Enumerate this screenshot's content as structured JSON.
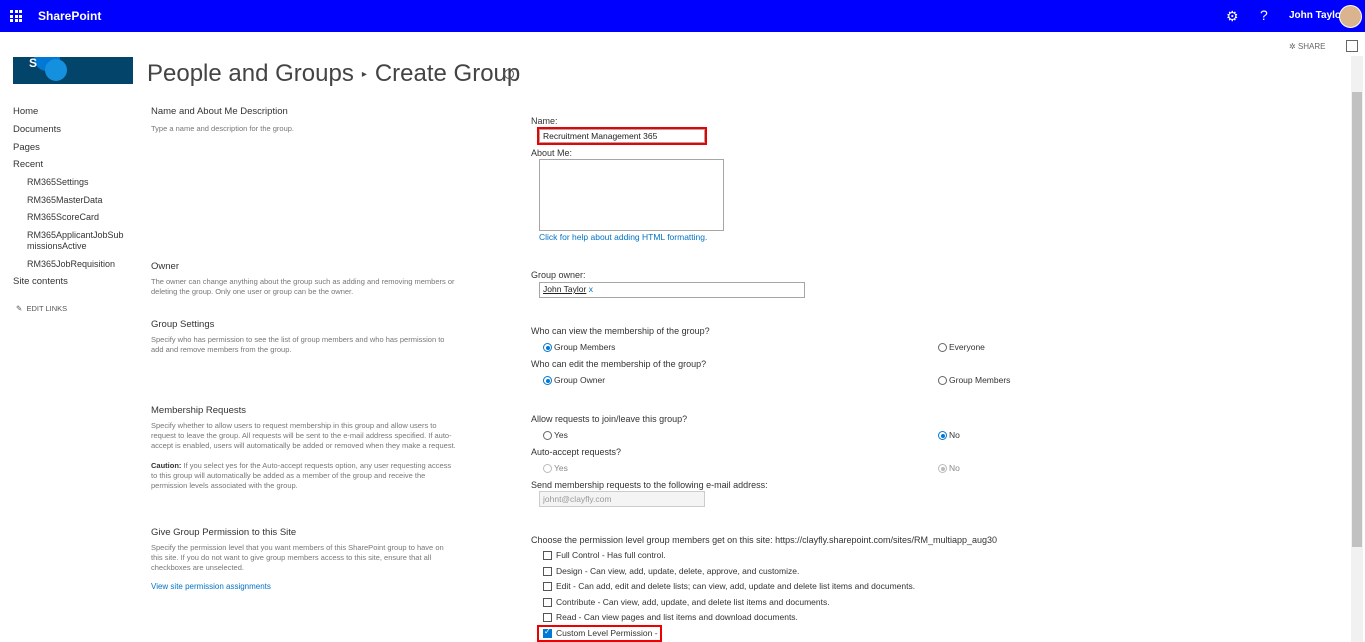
{
  "suitebar": {
    "app_name": "SharePoint",
    "user_name": "John Taylor"
  },
  "commandbar": {
    "share_label": "SHARE"
  },
  "page": {
    "breadcrumb_parent": "People and Groups",
    "breadcrumb_separator": "▸",
    "title": "Create Group"
  },
  "nav": {
    "items": [
      "Home",
      "Documents",
      "Pages",
      "Recent"
    ],
    "recent": [
      "RM365Settings",
      "RM365MasterData",
      "RM365ScoreCard",
      "RM365ApplicantJobSub",
      "missionsActive",
      "RM365JobRequisition"
    ],
    "site_contents": "Site contents",
    "edit_links": "EDIT LINKS"
  },
  "sections": {
    "name": {
      "heading": "Name and About Me Description",
      "desc": "Type a name and description for the group.",
      "name_label": "Name:",
      "name_value": "Recruitment Management 365",
      "about_label": "About Me:",
      "help_link": "Click for help about adding HTML formatting."
    },
    "owner": {
      "heading": "Owner",
      "desc1": "The owner can change anything about the group such as adding and removing members or",
      "desc2": "deleting the group. Only one user or group can be the owner.",
      "label": "Group owner:",
      "value": "John Taylor",
      "remove": "x"
    },
    "settings": {
      "heading": "Group Settings",
      "desc1": "Specify who has permission to see the list of group members and who has permission to",
      "desc2": "add and remove members from the group.",
      "view_q": "Who can view the membership of the group?",
      "view_opt1": "Group Members",
      "view_opt2": "Everyone",
      "edit_q": "Who can edit the membership of the group?",
      "edit_opt1": "Group Owner",
      "edit_opt2": "Group Members"
    },
    "membership": {
      "heading": "Membership Requests",
      "desc1": "Specify whether to allow users to request membership in this group and allow users to",
      "desc2": "request to leave the group. All requests will be sent to the e-mail address specified. If auto-",
      "desc3": "accept is enabled, users will automatically be added or removed when they make a request.",
      "caution_label": "Caution:",
      "caution1": " If you select yes for the Auto-accept requests option, any user requesting access",
      "caution2": "to this group will automatically be added as a member of the group and receive the",
      "caution3": "permission levels associated with the group.",
      "allow_q": "Allow requests to join/leave this group?",
      "yes": "Yes",
      "no": "No",
      "auto_q": "Auto-accept requests?",
      "email_label": "Send membership requests to the following e-mail address:",
      "email_value": "johnt@clayfly.com"
    },
    "permission": {
      "heading": "Give Group Permission to this Site",
      "desc1": "Specify the permission level that you want members of this SharePoint group to have on",
      "desc2": "this site. If you do not want to give group members access to this site, ensure that all",
      "desc3": "checkboxes are unselected.",
      "view_link": "View site permission assignments",
      "choose_label": "Choose the permission level group members get on this site: https://clayfly.sharepoint.com/sites/RM_multiapp_aug30",
      "options": [
        "Full Control - Has full control.",
        "Design - Can view, add, update, delete, approve, and customize.",
        "Edit - Can add, edit and delete lists; can view, add, update and delete list items and documents.",
        "Contribute - Can view, add, update, and delete list items and documents.",
        "Read - Can view pages and list items and download documents.",
        "Custom Level Permission -"
      ]
    }
  }
}
